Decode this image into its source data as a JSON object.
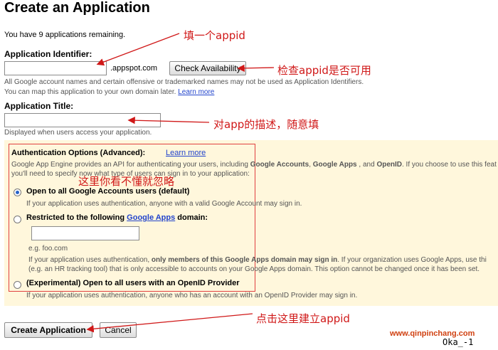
{
  "header": {
    "title": "Create an Application"
  },
  "intro": "You have 9 applications remaining.",
  "identifier": {
    "label": "Application Identifier:",
    "value": "",
    "suffix": ".appspot.com",
    "check_button": "Check Availability",
    "note1": "All Google account names and certain offensive or trademarked names may not be used as Application Identifiers.",
    "note2": "You can map this application to your own domain later.",
    "learn_more": "Learn more"
  },
  "title_field": {
    "label": "Application Title:",
    "value": "",
    "note": "Displayed when users access your application."
  },
  "auth": {
    "heading": "Authentication Options (Advanced):",
    "learn_more": "Learn more",
    "desc1_a": "Google App Engine provides an API for authenticating your users, including ",
    "desc1_b": "Google Accounts",
    "desc1_c": ", ",
    "desc1_d": "Google Apps",
    "desc1_e": " , and ",
    "desc1_f": "OpenID",
    "desc1_g": ". If you choose to use this feat",
    "desc2": "you'll need to specify now what type of users can sign in to your application:",
    "options": [
      {
        "label": "Open to all Google Accounts users (default)",
        "note": "If your application uses authentication, anyone with a valid Google Account may sign in.",
        "selected": true
      },
      {
        "label_a": "Restricted to the following ",
        "label_link": "Google Apps",
        "label_b": " domain:",
        "domain_value": "",
        "example": "e.g. foo.com",
        "note_a": "If your application uses authentication, ",
        "note_b": "only members of this Google Apps domain may sign in",
        "note_c": ". If your organization uses Google Apps, use thi",
        "note2": "(e.g. an HR tracking tool) that is only accessible to accounts on your Google Apps domain. This option cannot be changed once it has been set.",
        "selected": false
      },
      {
        "label": "(Experimental) Open to all users with an OpenID Provider",
        "note": "If your application uses authentication, anyone who has an account with an OpenID Provider may sign in.",
        "selected": false
      }
    ]
  },
  "actions": {
    "create": "Create Application",
    "cancel": "Cancel"
  },
  "annotations": {
    "fill_appid": "填一个appid",
    "check_appid": "检查appid是否可用",
    "describe_app": "对app的描述，随意填",
    "ignore_here": "这里你看不懂就忽略",
    "click_create": "点击这里建立appid"
  },
  "watermark": {
    "site": "www.qinpinchang.com",
    "tag": "Oka_-1"
  },
  "colors": {
    "annotation_red": "#d01818",
    "panel_bg": "#fff7dc",
    "link": "#2244cc"
  }
}
